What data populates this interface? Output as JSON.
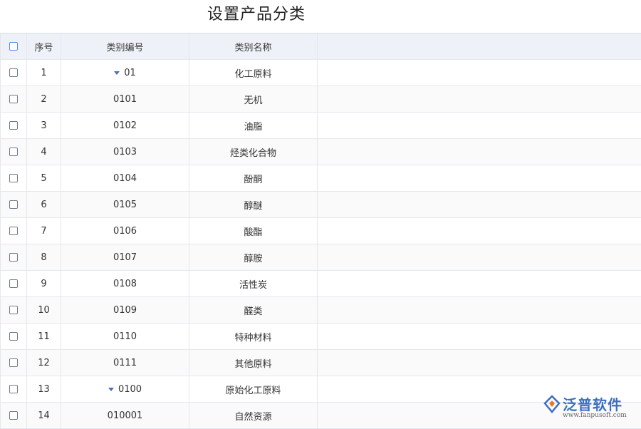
{
  "page": {
    "title": "设置产品分类"
  },
  "columns": {
    "seq": "序号",
    "code": "类别编号",
    "name": "类别名称"
  },
  "rows": [
    {
      "seq": "1",
      "code": "01",
      "name": "化工原料",
      "expanded": true
    },
    {
      "seq": "2",
      "code": "0101",
      "name": "无机"
    },
    {
      "seq": "3",
      "code": "0102",
      "name": "油脂"
    },
    {
      "seq": "4",
      "code": "0103",
      "name": "烃类化合物"
    },
    {
      "seq": "5",
      "code": "0104",
      "name": "酚酮"
    },
    {
      "seq": "6",
      "code": "0105",
      "name": "醇醚"
    },
    {
      "seq": "7",
      "code": "0106",
      "name": "酸酯"
    },
    {
      "seq": "8",
      "code": "0107",
      "name": "醇胺"
    },
    {
      "seq": "9",
      "code": "0108",
      "name": "活性炭"
    },
    {
      "seq": "10",
      "code": "0109",
      "name": "醛类"
    },
    {
      "seq": "11",
      "code": "0110",
      "name": "特种材料"
    },
    {
      "seq": "12",
      "code": "0111",
      "name": "其他原料"
    },
    {
      "seq": "13",
      "code": "0100",
      "name": "原始化工原料",
      "expanded": true
    },
    {
      "seq": "14",
      "code": "010001",
      "name": "自然资源"
    }
  ],
  "watermark": {
    "brand": "泛普软件",
    "url": "www.fanpusoft.com"
  },
  "colors": {
    "accent": "#3b6fc4",
    "header_bg": "#eef2f8"
  }
}
